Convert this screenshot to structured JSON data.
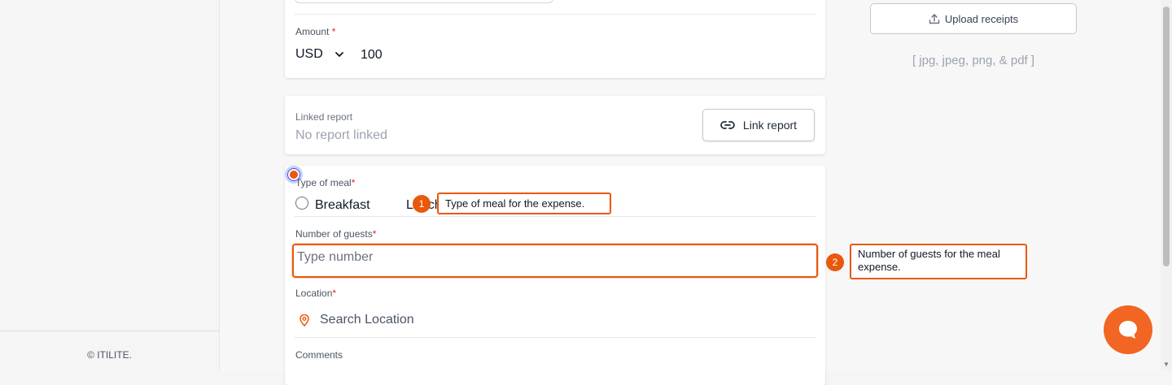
{
  "sidebar": {
    "copyright": "© ITILITE."
  },
  "amount": {
    "label": "Amount",
    "required_mark": "*",
    "currency": "USD",
    "value": "100"
  },
  "linked_report": {
    "label": "Linked report",
    "status": "No report linked",
    "button_label": "Link report"
  },
  "meal": {
    "label": "Type of meal",
    "required_mark": "*",
    "options": [
      {
        "label": "Breakfast",
        "selected": false
      },
      {
        "label": "Lunch",
        "selected": true
      }
    ]
  },
  "guests": {
    "label": "Number of guests",
    "required_mark": "*",
    "placeholder": "Type number"
  },
  "location": {
    "label": "Location",
    "required_mark": "*",
    "placeholder": "Search Location"
  },
  "comments": {
    "label": "Comments"
  },
  "upload": {
    "button_label": "Upload receipts",
    "file_types": "[ jpg, jpeg, png, & pdf ]"
  },
  "annotations": [
    {
      "number": "1",
      "text": "Type of meal for the expense."
    },
    {
      "number": "2",
      "text": "Number of guests for the meal expense."
    }
  ],
  "colors": {
    "accent": "#ea580c",
    "chat": "#f26522",
    "required": "#dc2626"
  }
}
